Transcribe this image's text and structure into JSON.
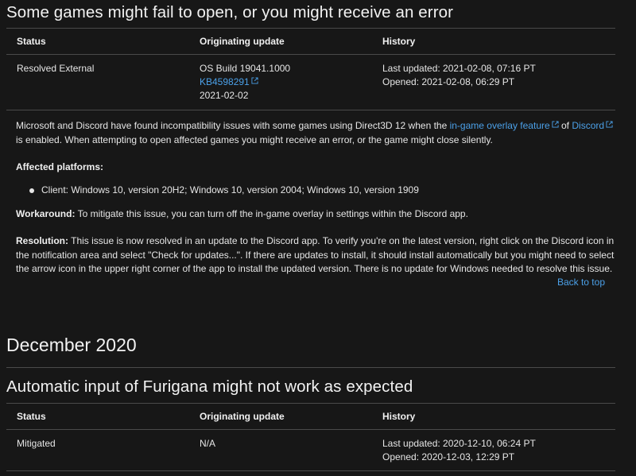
{
  "issue1": {
    "title": "Some games might fail to open, or you might receive an error",
    "headers": {
      "status": "Status",
      "update": "Originating update",
      "history": "History"
    },
    "row": {
      "status": "Resolved External",
      "build": "OS Build 19041.1000",
      "kb": "KB4598291",
      "date": "2021-02-02",
      "last_updated": "Last updated: 2021-02-08, 07:16 PT",
      "opened": "Opened: 2021-02-08, 06:29 PT"
    },
    "description": {
      "pre": "Microsoft and Discord have found incompatibility issues with some games using Direct3D 12 when the ",
      "link1": "in-game overlay feature",
      "mid": " of ",
      "link2": "Discord",
      "post": " is enabled. When attempting to open affected games you might receive an error, or the game might close silently."
    },
    "affected_label": "Affected platforms:",
    "platforms": "Client: Windows 10, version 20H2; Windows 10, version 2004; Windows 10, version 1909",
    "workaround_label": "Workaround:",
    "workaround_text": " To mitigate this issue, you can turn off the in-game overlay in settings within the Discord app.",
    "resolution_label": "Resolution:",
    "resolution_text": " This issue is now resolved in an update to the Discord app. To verify you're on the latest version, right click on the Discord icon in the notification area and select \"Check for updates...\". If there are updates to install, it should install automatically but you might need to select the arrow icon in the upper right corner of the app to install the updated version. There is no update for Windows needed to resolve this issue.",
    "back_to_top": "Back to top"
  },
  "month_heading": "December 2020",
  "issue2": {
    "title": "Automatic input of Furigana might not work as expected",
    "headers": {
      "status": "Status",
      "update": "Originating update",
      "history": "History"
    },
    "row": {
      "status": "Mitigated",
      "update": "N/A",
      "last_updated": "Last updated: 2020-12-10, 06:24 PT",
      "opened": "Opened: 2020-12-03, 12:29 PT"
    }
  },
  "colors": {
    "background": "#171717",
    "text": "#e6e6e6",
    "link": "#4ba0e8",
    "divider": "#4a4a4a"
  },
  "icons": {
    "external": "external-link-icon"
  }
}
